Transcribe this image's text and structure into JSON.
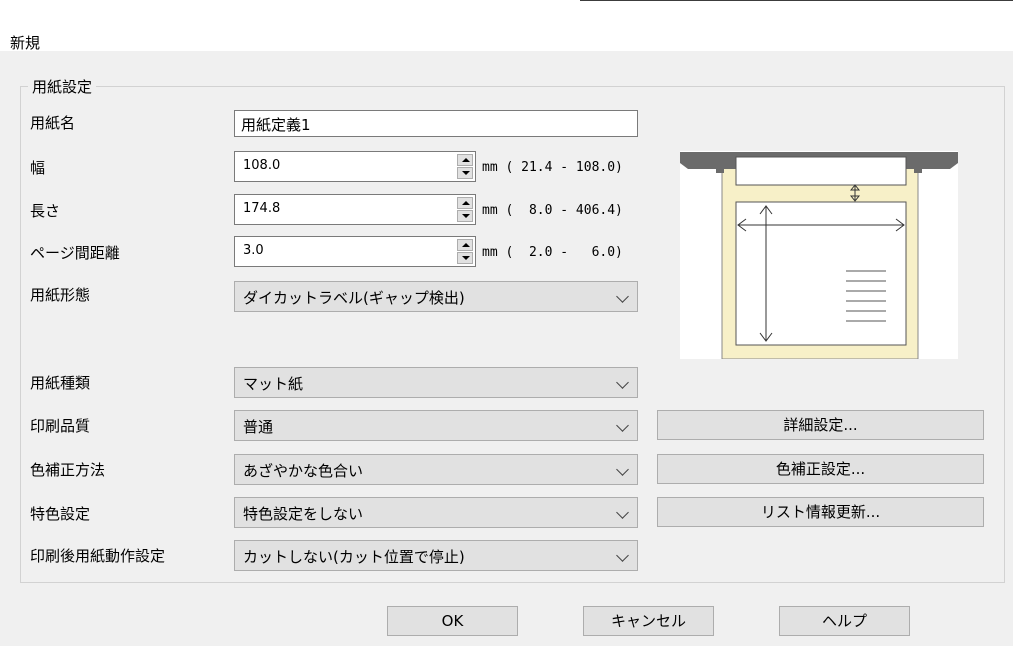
{
  "window": {
    "title": "新規"
  },
  "group": {
    "label": "用紙設定"
  },
  "labels": {
    "paper_name": "用紙名",
    "width": "幅",
    "length": "長さ",
    "page_gap": "ページ間距離",
    "paper_form": "用紙形態",
    "paper_type": "用紙種類",
    "print_quality": "印刷品質",
    "color_correction": "色補正方法",
    "spot_color": "特色設定",
    "after_print": "印刷後用紙動作設定"
  },
  "fields": {
    "paper_name": "用紙定義1",
    "width": "108.0",
    "width_range": "mm ( 21.4 - 108.0)",
    "length": "174.8",
    "length_range": "mm (  8.0 - 406.4)",
    "page_gap": "3.0",
    "page_gap_range": "mm (  2.0 -   6.0)",
    "paper_form": "ダイカットラベル(ギャップ検出)",
    "paper_type": "マット紙",
    "print_quality": "普通",
    "color_correction": "あざやかな色合い",
    "spot_color": "特色設定をしない",
    "after_print": "カットしない(カット位置で停止)"
  },
  "side_buttons": {
    "detail": "詳細設定...",
    "color_correction": "色補正設定...",
    "list_update": "リスト情報更新..."
  },
  "footer": {
    "ok": "OK",
    "cancel": "キャンセル",
    "help": "ヘルプ"
  },
  "colors": {
    "paper": "#f7f0c8",
    "printer": "#6b6b6b",
    "window_bg": "#f0f0f0"
  }
}
